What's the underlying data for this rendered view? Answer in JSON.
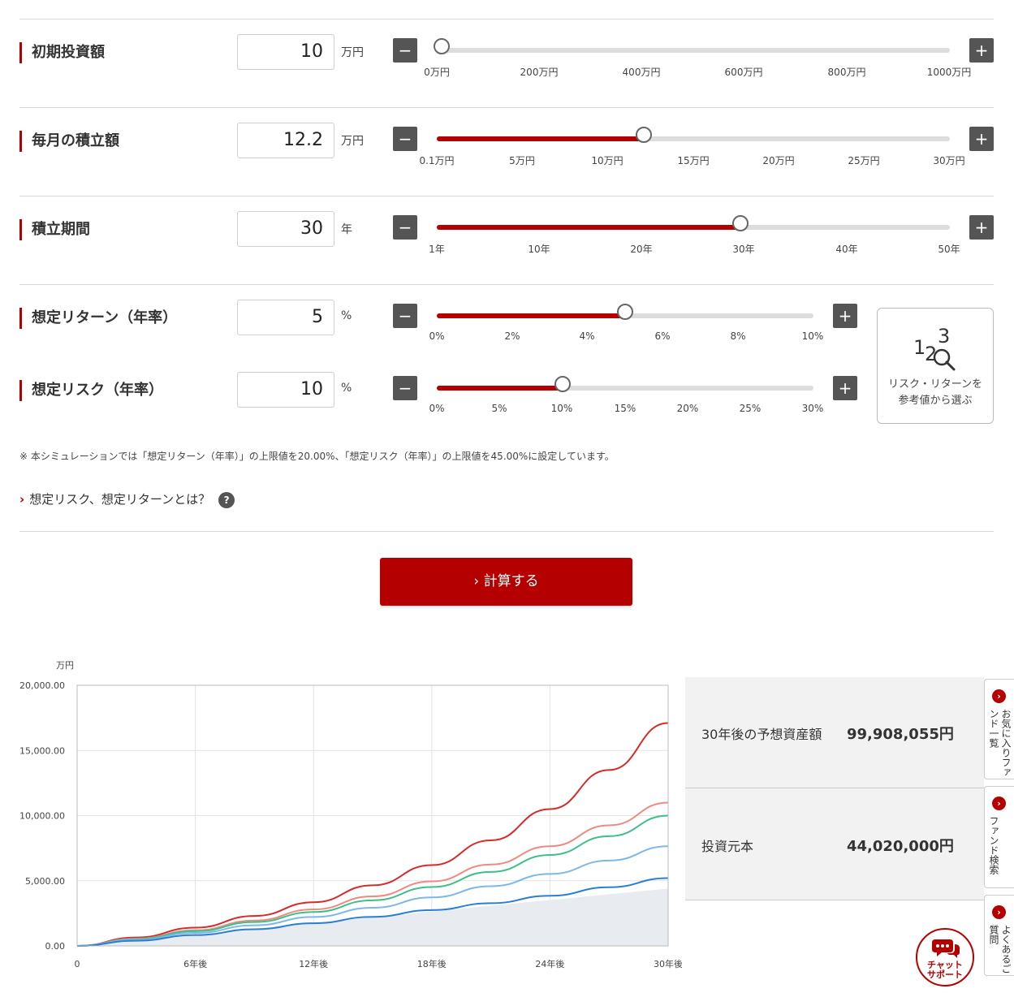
{
  "rows": [
    {
      "label": "初期投資額",
      "value": "10",
      "unit": "万円",
      "minus": "−",
      "plus": "+",
      "fraction": 0.01,
      "ticks": [
        "0万円",
        "200万円",
        "400万円",
        "600万円",
        "800万円",
        "1000万円"
      ]
    },
    {
      "label": "毎月の積立額",
      "value": "12.2",
      "unit": "万円",
      "minus": "−",
      "plus": "+",
      "fraction": 0.403,
      "ticks": [
        "0.1万円",
        "5万円",
        "10万円",
        "15万円",
        "20万円",
        "25万円",
        "30万円"
      ]
    },
    {
      "label": "積立期間",
      "value": "30",
      "unit": "年",
      "minus": "−",
      "plus": "+",
      "fraction": 0.592,
      "ticks": [
        "1年",
        "10年",
        "20年",
        "30年",
        "40年",
        "50年"
      ]
    },
    {
      "label": "想定リターン（年率）",
      "value": "5",
      "unit": "%",
      "minus": "−",
      "plus": "+",
      "fraction": 0.5,
      "ticks": [
        "0%",
        "2%",
        "4%",
        "6%",
        "8%",
        "10%"
      ]
    },
    {
      "label": "想定リスク（年率）",
      "value": "10",
      "unit": "%",
      "minus": "−",
      "plus": "+",
      "fraction": 0.3333,
      "ticks": [
        "0%",
        "5%",
        "10%",
        "15%",
        "20%",
        "25%",
        "30%"
      ]
    }
  ],
  "reference_box": {
    "line1": "リスク・リターンを",
    "line2": "参考値から選ぶ",
    "icon": "number-search-icon"
  },
  "note": "※ 本シミュレーションでは「想定リターン（年率）」の上限値を20.00%、「想定リスク（年率）」の上限値を45.00%に設定しています。",
  "link": {
    "chevron": "›",
    "text": "想定リスク、想定リターンとは？",
    "help": "?"
  },
  "calculate_button": "› 計算する",
  "chart_data": {
    "type": "line",
    "ylabel": "万円",
    "y_ticks": [
      "20,000.00",
      "15,000.00",
      "10,000.00",
      "5,000.00",
      "0.00"
    ],
    "x_ticks": [
      "0",
      "6年後",
      "12年後",
      "18年後",
      "24年後",
      "30年後"
    ],
    "ylim": [
      0,
      20000
    ],
    "xlim": [
      0,
      30
    ],
    "grid": true,
    "x": [
      0,
      3,
      6,
      9,
      12,
      15,
      18,
      21,
      24,
      27,
      30
    ],
    "series": [
      {
        "color": "#d62b2b",
        "values": [
          0,
          650,
          1400,
          2300,
          3350,
          4650,
          6200,
          8100,
          10500,
          13500,
          17100
        ]
      },
      {
        "color": "#f08a80",
        "values": [
          0,
          560,
          1200,
          1950,
          2800,
          3800,
          4950,
          6250,
          7650,
          9250,
          11000
        ]
      },
      {
        "color": "#3cc08a",
        "values": [
          0,
          530,
          1130,
          1830,
          2600,
          3500,
          4520,
          5680,
          6980,
          8420,
          10000
        ]
      },
      {
        "color": "#7db8e6",
        "values": [
          0,
          470,
          1000,
          1580,
          2220,
          2930,
          3720,
          4580,
          5520,
          6550,
          7650
        ]
      },
      {
        "color": "#2a7fd4",
        "values": [
          0,
          400,
          830,
          1280,
          1740,
          2230,
          2750,
          3280,
          3850,
          4500,
          5200
        ]
      }
    ],
    "principal": {
      "color": "#e8ebf0",
      "values": [
        0,
        449,
        888,
        1327,
        1767,
        2206,
        2645,
        3085,
        3524,
        3963,
        4402
      ]
    }
  },
  "results": [
    {
      "label": "30年後の予想資産額",
      "value": "99,908,055円"
    },
    {
      "label": "投資元本",
      "value": "44,020,000円"
    }
  ],
  "side_tabs": [
    {
      "text": "お気に入りファンド一覧",
      "icon": "chevron-right-icon"
    },
    {
      "text": "ファンド検索",
      "icon": "chevron-right-icon"
    },
    {
      "text": "よくあるご質問",
      "icon": "chevron-right-icon"
    }
  ],
  "chat": {
    "line1": "チャット",
    "line2": "サポート"
  }
}
